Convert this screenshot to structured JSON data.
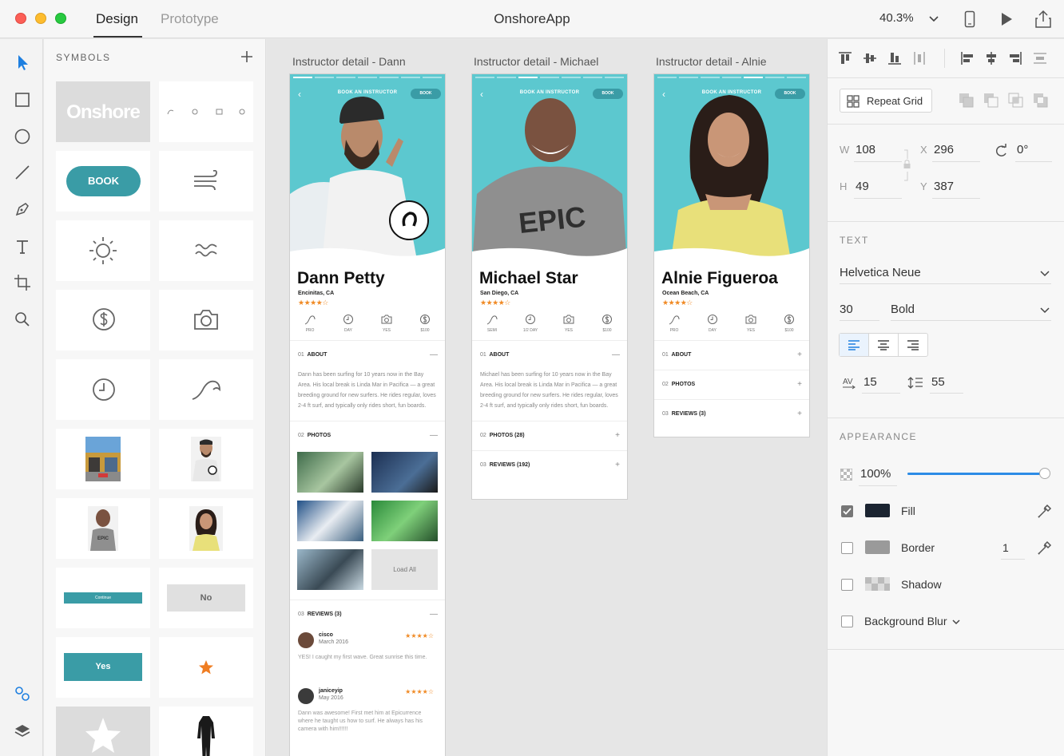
{
  "titlebar": {
    "tabs": [
      "Design",
      "Prototype"
    ],
    "title": "OnshoreApp",
    "zoom": "40.3%"
  },
  "symbols": {
    "header": "SYMBOLS",
    "logo_text": "Onshore",
    "book_label": "BOOK",
    "continue_label": "Continue",
    "no_label": "No",
    "yes_label": "Yes"
  },
  "artboards": [
    {
      "title": "Instructor detail - Dann",
      "header": "BOOK AN INSTRUCTOR",
      "book": "BOOK",
      "name": "Dann Petty",
      "location": "Encinitas, CA",
      "stars": "★★★★☆",
      "features": [
        {
          "icon": "wave-icon",
          "label": "PRO"
        },
        {
          "icon": "clock-icon",
          "label": "DAY"
        },
        {
          "icon": "camera-icon",
          "label": "YES"
        },
        {
          "icon": "dollar-icon",
          "label": "$100"
        }
      ],
      "about_num": "01",
      "about_label": "ABOUT",
      "about_text": "Dann has been surfing for 10 years now in the Bay Area. His local break is Linda Mar in Pacifica — a great breeding ground for new surfers. He rides regular, loves 2-4 ft surf, and typically only rides short, fun boards.",
      "photos_num": "02",
      "photos_label": "PHOTOS",
      "load_all": "Load All",
      "reviews_num": "03",
      "reviews_label": "REVIEWS (3)",
      "reviews": [
        {
          "name": "cisco",
          "date": "March 2016",
          "stars": "★★★★☆",
          "text": "YES! I caught my first wave. Great sunrise this time."
        },
        {
          "name": "janiceyip",
          "date": "May 2016",
          "stars": "★★★★☆",
          "text": "Dann was awesome! First met him at Epicurrence where he taught us how to surf. He always has his camera with him!!!!!!"
        }
      ]
    },
    {
      "title": "Instructor detail - Michael",
      "header": "BOOK AN INSTRUCTOR",
      "book": "BOOK",
      "name": "Michael Star",
      "location": "San Diego, CA",
      "stars": "★★★★☆",
      "shirt_text": "EPIC",
      "features": [
        {
          "icon": "wave-icon",
          "label": "SEMI"
        },
        {
          "icon": "clock-icon",
          "label": "1/2 DAY"
        },
        {
          "icon": "camera-icon",
          "label": "YES"
        },
        {
          "icon": "dollar-icon",
          "label": "$100"
        }
      ],
      "about_num": "01",
      "about_label": "ABOUT",
      "about_text": "Michael has been surfing for 10 years now in the Bay Area. His local break is Linda Mar in Pacifica — a great breeding ground for new surfers. He rides regular, loves 2-4 ft surf, and typically only rides short, fun boards.",
      "photos_num": "02",
      "photos_label": "PHOTOS (28)",
      "reviews_num": "03",
      "reviews_label": "REVIEWS (192)"
    },
    {
      "title": "Instructor detail - Alnie",
      "header": "BOOK AN INSTRUCTOR",
      "book": "BOOK",
      "name": "Alnie Figueroa",
      "location": "Ocean Beach, CA",
      "stars": "★★★★☆",
      "features": [
        {
          "icon": "wave-icon",
          "label": "PRO"
        },
        {
          "icon": "clock-icon",
          "label": "DAY"
        },
        {
          "icon": "camera-icon",
          "label": "YES"
        },
        {
          "icon": "dollar-icon",
          "label": "$100"
        }
      ],
      "about_num": "01",
      "about_label": "ABOUT",
      "photos_num": "02",
      "photos_label": "PHOTOS",
      "reviews_num": "03",
      "reviews_label": "REVIEWS (3)"
    }
  ],
  "properties": {
    "repeat_grid": "Repeat Grid",
    "w_label": "W",
    "w": "108",
    "x_label": "X",
    "x": "296",
    "rotation": "0°",
    "h_label": "H",
    "h": "49",
    "y_label": "Y",
    "y": "387",
    "text_section": "TEXT",
    "font_family": "Helvetica Neue",
    "font_size": "30",
    "font_weight": "Bold",
    "char_spacing": "15",
    "line_spacing": "55",
    "appearance_section": "APPEARANCE",
    "opacity": "100%",
    "opacity_level": 1.0,
    "fill_label": "Fill",
    "fill_color": "#1b2431",
    "fill_checked": true,
    "border_label": "Border",
    "border_width": "1",
    "border_checked": false,
    "shadow_label": "Shadow",
    "shadow_checked": false,
    "blur_label": "Background Blur",
    "blur_checked": false
  },
  "colors": {
    "accent": "#3a9ca6",
    "teal_bg": "#5cc8cf",
    "star": "#f08a24",
    "selection": "#2d8ce6"
  }
}
